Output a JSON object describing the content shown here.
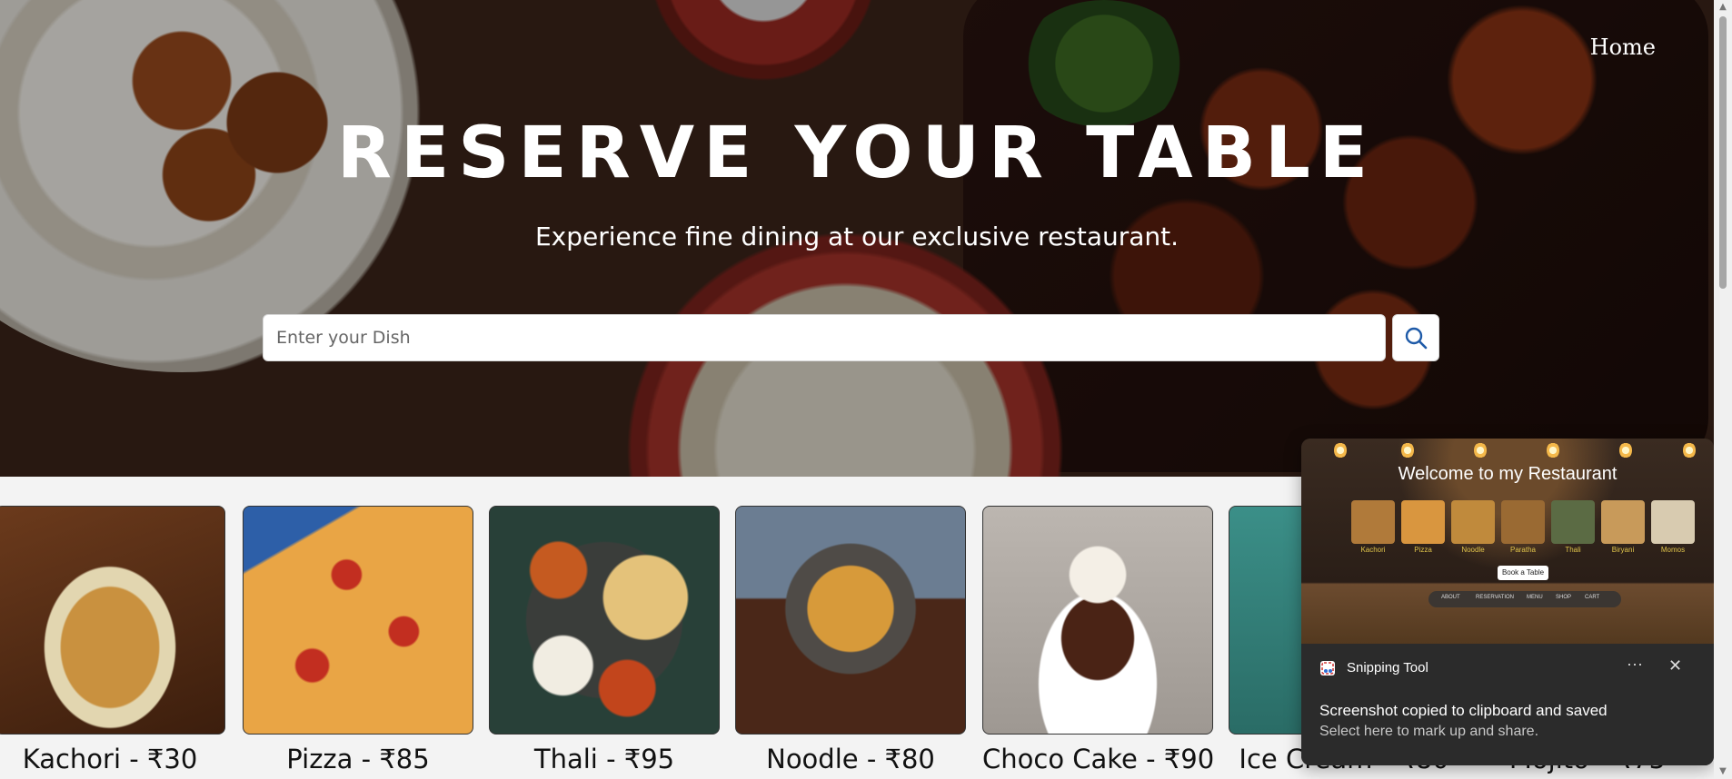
{
  "nav": {
    "home_label": "Home"
  },
  "hero": {
    "title": "RESERVE YOUR TABLE",
    "subtitle": "Experience fine dining at our exclusive restaurant.",
    "search": {
      "placeholder": "Enter your Dish",
      "value": ""
    },
    "search_icon": "search-icon"
  },
  "menu": {
    "items": [
      {
        "label": "Kachori - ₹30"
      },
      {
        "label": "Pizza - ₹85"
      },
      {
        "label": "Thali - ₹95"
      },
      {
        "label": "Noodle - ₹80"
      },
      {
        "label": "Choco Cake - ₹90"
      },
      {
        "label": "Ice Cream - ₹80"
      },
      {
        "label": "Mojito - ₹75"
      }
    ]
  },
  "preview": {
    "title": "Welcome to my Restaurant",
    "thumbs": [
      "Kachori",
      "Pizza",
      "Noodle",
      "Paratha",
      "Thali",
      "Biryani",
      "Momos"
    ],
    "book_label": "Book a Table",
    "nav": [
      "ABOUT",
      "RESERVATION",
      "MENU",
      "SHOP",
      "CART"
    ]
  },
  "snipping": {
    "app_name": "Snipping Tool",
    "more_label": "···",
    "close_label": "✕",
    "message": "Screenshot copied to clipboard and saved",
    "submessage": "Select here to mark up and share."
  },
  "colors": {
    "accent": "#ffffff",
    "label_gold": "#e0c44b",
    "toast_bg": "#2b2b2b"
  }
}
